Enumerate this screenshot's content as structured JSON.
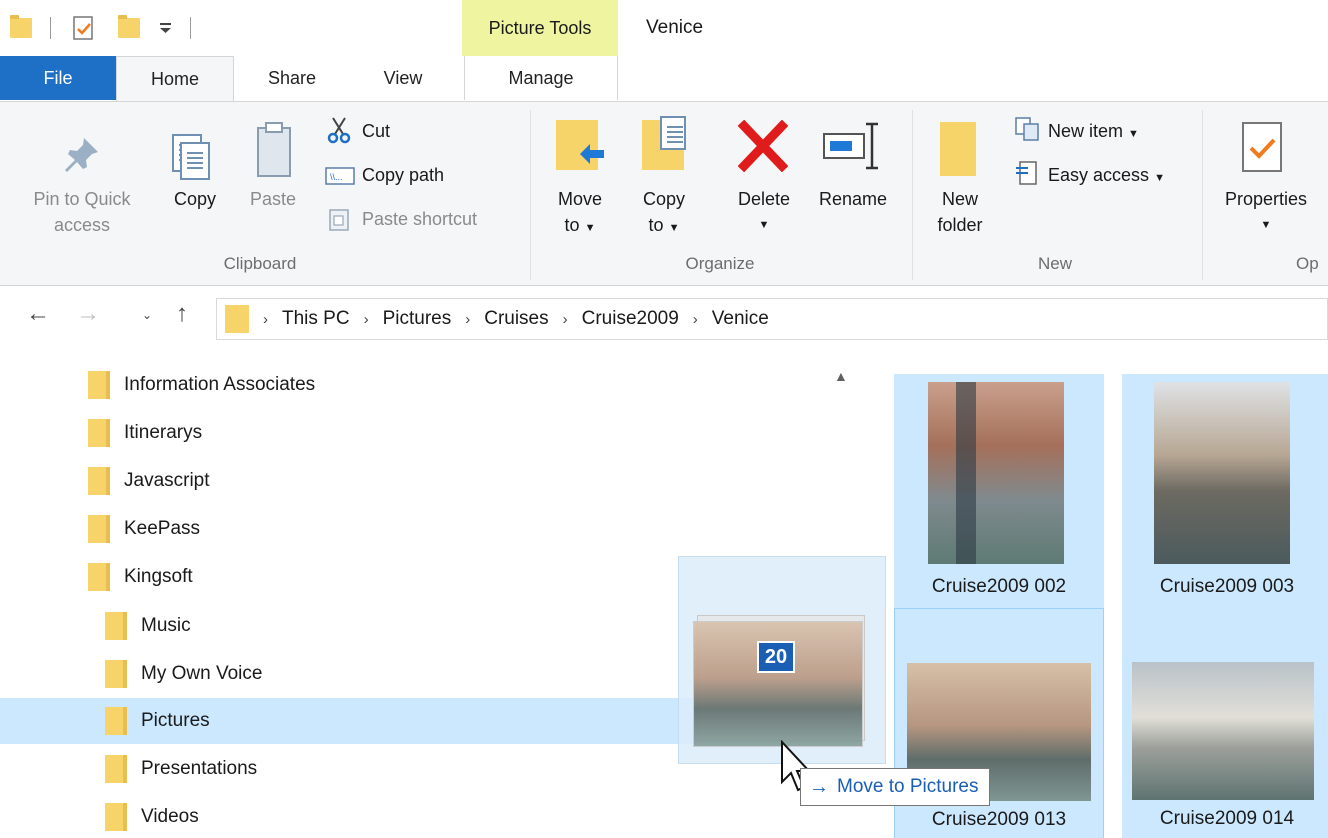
{
  "window": {
    "title": "Venice",
    "context_tab_group": "Picture Tools"
  },
  "tabs": {
    "file": "File",
    "home": "Home",
    "share": "Share",
    "view": "View",
    "manage": "Manage"
  },
  "ribbon": {
    "clipboard": {
      "group_label": "Clipboard",
      "pin_label_1": "Pin to Quick",
      "pin_label_2": "access",
      "copy_label": "Copy",
      "paste_label": "Paste",
      "cut_label": "Cut",
      "copy_path_label": "Copy path",
      "paste_shortcut_label": "Paste shortcut"
    },
    "organize": {
      "group_label": "Organize",
      "move_to_1": "Move",
      "move_to_2": "to",
      "copy_to_1": "Copy",
      "copy_to_2": "to",
      "delete_label": "Delete",
      "rename_label": "Rename"
    },
    "new": {
      "group_label": "New",
      "new_folder_1": "New",
      "new_folder_2": "folder",
      "new_item_label": "New item",
      "easy_access_label": "Easy access"
    },
    "open": {
      "group_label": "Op",
      "properties_label": "Properties"
    }
  },
  "breadcrumb": [
    "This PC",
    "Pictures",
    "Cruises",
    "Cruise2009",
    "Venice"
  ],
  "tree": [
    {
      "label": "Information Associates"
    },
    {
      "label": "Itinerarys"
    },
    {
      "label": "Javascript"
    },
    {
      "label": "KeePass"
    },
    {
      "label": "Kingsoft"
    },
    {
      "label": "Music"
    },
    {
      "label": "My Own Voice"
    },
    {
      "label": "Pictures",
      "selected": true
    },
    {
      "label": "Presentations"
    },
    {
      "label": "Videos"
    }
  ],
  "files": [
    {
      "name": "Cruise2009 002"
    },
    {
      "name": "Cruise2009 003"
    },
    {
      "name": "Cruise2009 013"
    },
    {
      "name": "Cruise2009 014"
    }
  ],
  "drag": {
    "count": "20",
    "tooltip": "Move to Pictures"
  },
  "colors": {
    "file_tab": "#1e6fc6",
    "selection": "#cce8ff",
    "context_tab": "#eef4a0",
    "folder": "#f7d46a",
    "delete_red": "#e01b1b"
  }
}
